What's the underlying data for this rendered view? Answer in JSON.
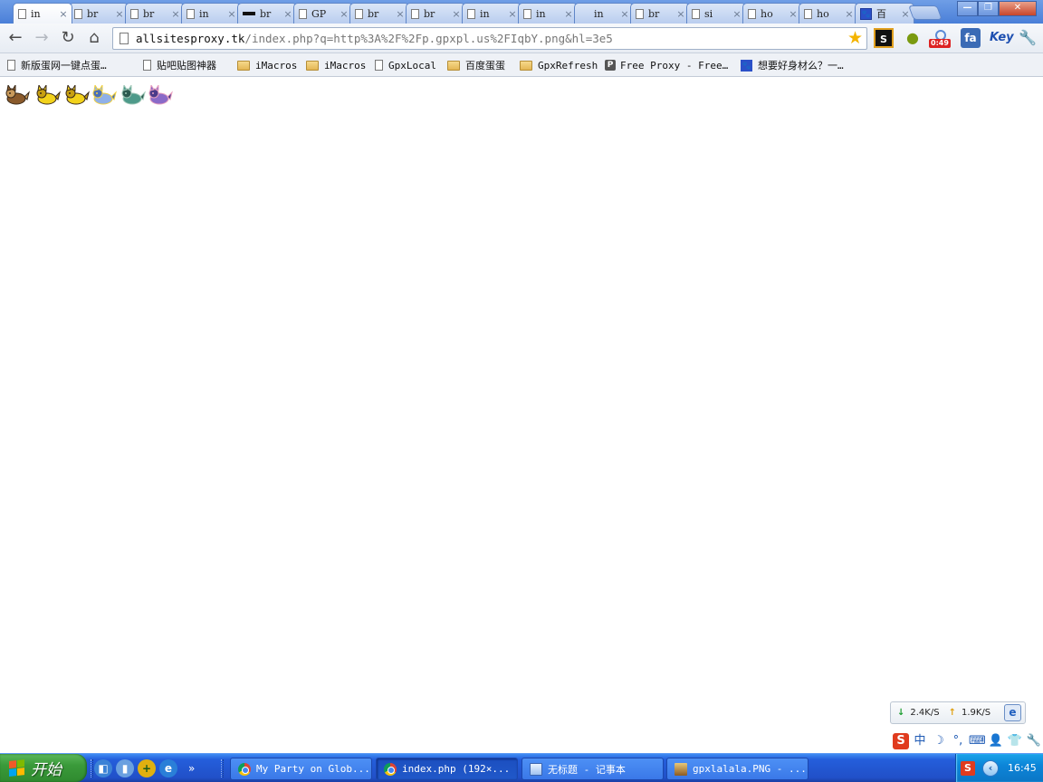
{
  "tabs": [
    {
      "title": "in",
      "icon": "page-icon",
      "active": true
    },
    {
      "title": "br",
      "icon": "page-icon"
    },
    {
      "title": "br",
      "icon": "page-icon"
    },
    {
      "title": "in",
      "icon": "page-icon"
    },
    {
      "title": "br",
      "icon": "dark-bar-icon"
    },
    {
      "title": "GP",
      "icon": "page-icon"
    },
    {
      "title": "br",
      "icon": "page-icon"
    },
    {
      "title": "br",
      "icon": "page-icon"
    },
    {
      "title": "in",
      "icon": "page-icon"
    },
    {
      "title": "in",
      "icon": "page-icon"
    },
    {
      "title": "in",
      "icon": "none"
    },
    {
      "title": "br",
      "icon": "page-icon"
    },
    {
      "title": "si",
      "icon": "page-icon"
    },
    {
      "title": "ho",
      "icon": "page-icon"
    },
    {
      "title": "ho",
      "icon": "page-icon"
    },
    {
      "title": "百",
      "icon": "baidu-paw-icon"
    }
  ],
  "tab_close_glyph": "×",
  "window_controls": {
    "minimize": "—",
    "maximize": "❐",
    "close": "✕"
  },
  "toolbar": {
    "back_glyph": "←",
    "forward_glyph": "→",
    "reload_glyph": "↻",
    "home_glyph": "⌂",
    "star_glyph": "★",
    "wrench_glyph": "🔧"
  },
  "address": {
    "host": "allsitesproxy.tk",
    "path": "/index.php?q=http%3A%2F%2Fp.gpxpl.us%2FIqbY.png&hl=3e5"
  },
  "extensions": {
    "s_label": "S",
    "egg_glyph": "●",
    "timer_badge": "0:49",
    "fa_label": "fa",
    "key_label": "Key"
  },
  "bookmarks": [
    {
      "label": "新版蛋网一键点蛋…",
      "icon": "page-icon"
    },
    {
      "label": "贴吧贴图神器",
      "icon": "page-icon"
    },
    {
      "label": "iMacros",
      "icon": "folder-icon"
    },
    {
      "label": "iMacros",
      "icon": "folder-icon"
    },
    {
      "label": "GpxLocal",
      "icon": "page-icon"
    },
    {
      "label": "百度蛋蛋",
      "icon": "folder-icon"
    },
    {
      "label": "GpxRefresh",
      "icon": "folder-icon"
    },
    {
      "label": "Free Proxy - Free…",
      "icon": "proxy-p-icon"
    },
    {
      "label": "想要好身材么？一…",
      "icon": "baidu-paw-icon"
    }
  ],
  "sprites": [
    {
      "name": "brown-creature",
      "colors": [
        "#8a5a2b",
        "#c99a5a",
        "#3a2a1a"
      ]
    },
    {
      "name": "yellow-creature-1",
      "colors": [
        "#f2d21b",
        "#c8a010",
        "#3a2a1a"
      ]
    },
    {
      "name": "yellow-creature-2",
      "colors": [
        "#f2d21b",
        "#c8a010",
        "#3a2a1a"
      ]
    },
    {
      "name": "blue-creature",
      "colors": [
        "#8fb0e8",
        "#4a6fb8",
        "#f0d040"
      ]
    },
    {
      "name": "teal-creature",
      "colors": [
        "#4e9a8a",
        "#2c5a50",
        "#a0c8b8"
      ]
    },
    {
      "name": "purple-creature",
      "colors": [
        "#8a6ac8",
        "#4a3a8a",
        "#e8a0c0"
      ]
    }
  ],
  "netspeed": {
    "down_glyph": "↓",
    "down": "2.4K/S",
    "up_glyph": "↑",
    "up": "1.9K/S",
    "ie_glyph": "e"
  },
  "ime": [
    "S",
    "中",
    "☽",
    "°,",
    "⌨",
    "👤",
    "👕",
    "🔧"
  ],
  "taskbar": {
    "start_label": "开始",
    "quicklaunch_more": "»",
    "tasks": [
      {
        "label": "My Party on Glob...",
        "icon": "chrome",
        "active": false
      },
      {
        "label": "index.php (192×...",
        "icon": "chrome",
        "active": true
      },
      {
        "label": "无标题 - 记事本",
        "icon": "notepad",
        "active": false
      },
      {
        "label": "gpxlalala.PNG - ...",
        "icon": "image",
        "active": false
      }
    ],
    "tray_sogou": "S",
    "tray_expand": "‹",
    "clock": "16:45"
  },
  "colors": {
    "taskbar_blue": "#2150c8",
    "start_green": "#3a9a3a",
    "tab_blue": "#4a7fd8"
  }
}
